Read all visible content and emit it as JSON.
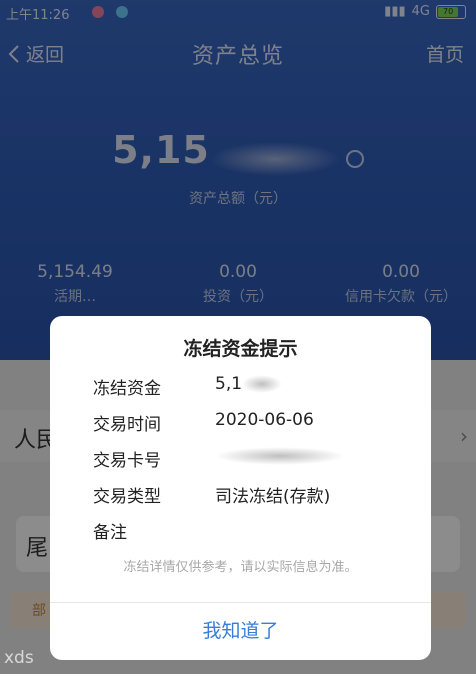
{
  "status_bar": {
    "time": "上午11:26",
    "network": "4G",
    "battery": "70"
  },
  "nav": {
    "back_icon": "chevron-left-icon",
    "back_label": "返回",
    "title": "资产总览",
    "home_label": "首页"
  },
  "summary": {
    "total_amount_visible": "5,15",
    "total_label": "资产总额（元）"
  },
  "stats": [
    {
      "value": "5,154.49",
      "label": "活期…"
    },
    {
      "value": "0.00",
      "label": "投资（元）"
    },
    {
      "value": "0.00",
      "label": "信用卡欠款（元）"
    }
  ],
  "background": {
    "row_label": "人民",
    "card_label": "尾",
    "strip_label": "部"
  },
  "dialog": {
    "title": "冻结资金提示",
    "rows": [
      {
        "key": "冻结资金",
        "value": "5,1"
      },
      {
        "key": "交易时间",
        "value": "2020-06-06"
      },
      {
        "key": "交易卡号",
        "value": ""
      },
      {
        "key": "交易类型",
        "value": "司法冻结(存款)"
      },
      {
        "key": "备注",
        "value": ""
      }
    ],
    "note": "冻结详情仅供参考，请以实际信息为准。",
    "ok_label": "我知道了"
  },
  "watermark": "xds"
}
